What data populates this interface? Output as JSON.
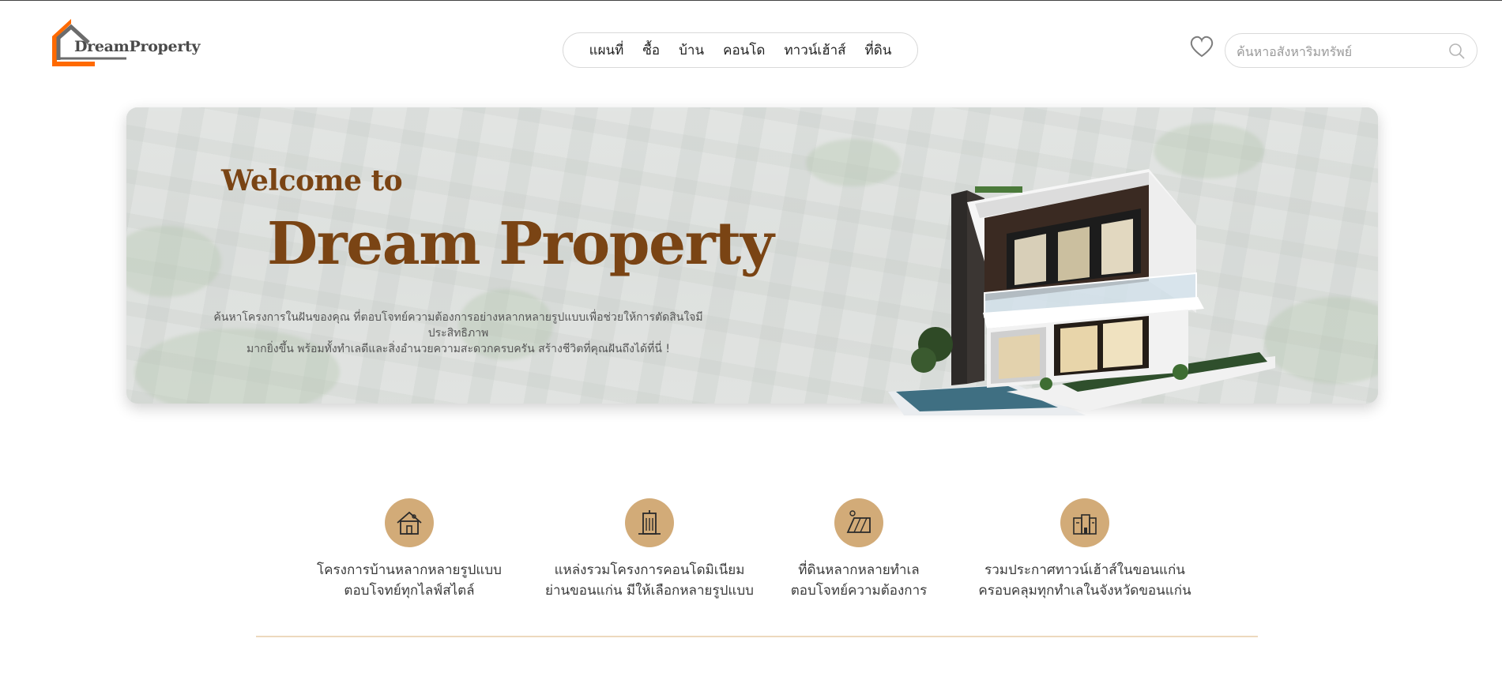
{
  "brand": {
    "name": "DreamProperty",
    "logo_color_primary": "#ff6a00",
    "logo_color_secondary": "#6b6b6b"
  },
  "nav": {
    "items": [
      "แผนที่",
      "ซื้อ",
      "บ้าน",
      "คอนโด",
      "ทาวน์เฮ้าส์",
      "ที่ดิน"
    ]
  },
  "header": {
    "favorite_icon": "heart-icon",
    "search": {
      "placeholder": "ค้นหาอสังหาริมทรัพย์",
      "value": ""
    }
  },
  "hero": {
    "welcome": "Welcome to",
    "title": "Dream Property",
    "description_line1": "ค้นหาโครงการในฝันของคุณ ที่ตอบโจทย์ความต้องการอย่างหลากหลายรูปแบบเพื่อช่วยให้การตัดสินใจมีประสิทธิภาพ",
    "description_line2": "มากยิ่งขึ้น พร้อมทั้งทำเลดีและสิ่งอำนวยความสะดวกครบครัน สร้างชีวิตที่คุณฝันถึงได้ที่นี่ !",
    "title_color": "#7a4414"
  },
  "features": [
    {
      "icon": "house-icon",
      "line1": "โครงการบ้านหลากหลายรูปแบบ",
      "line2": "ตอบโจทย์ทุกไลฟ์สไตล์"
    },
    {
      "icon": "condo-building-icon",
      "line1": "แหล่งรวมโครงการคอนโดมิเนียม",
      "line2": "ย่านขอนแก่น มีให้เลือกหลายรูปแบบ"
    },
    {
      "icon": "land-plot-icon",
      "line1": "ที่ดินหลากหลายทำเล",
      "line2": "ตอบโจทย์ความต้องการ"
    },
    {
      "icon": "townhouse-icon",
      "line1": "รวมประกาศทาวน์เฮ้าส์ในขอนแก่น",
      "line2": "ครอบคลุมทุกทำเลในจังหวัดขอนแก่น"
    }
  ],
  "colors": {
    "accent": "#d2ab78",
    "divider": "#edd9bd"
  }
}
